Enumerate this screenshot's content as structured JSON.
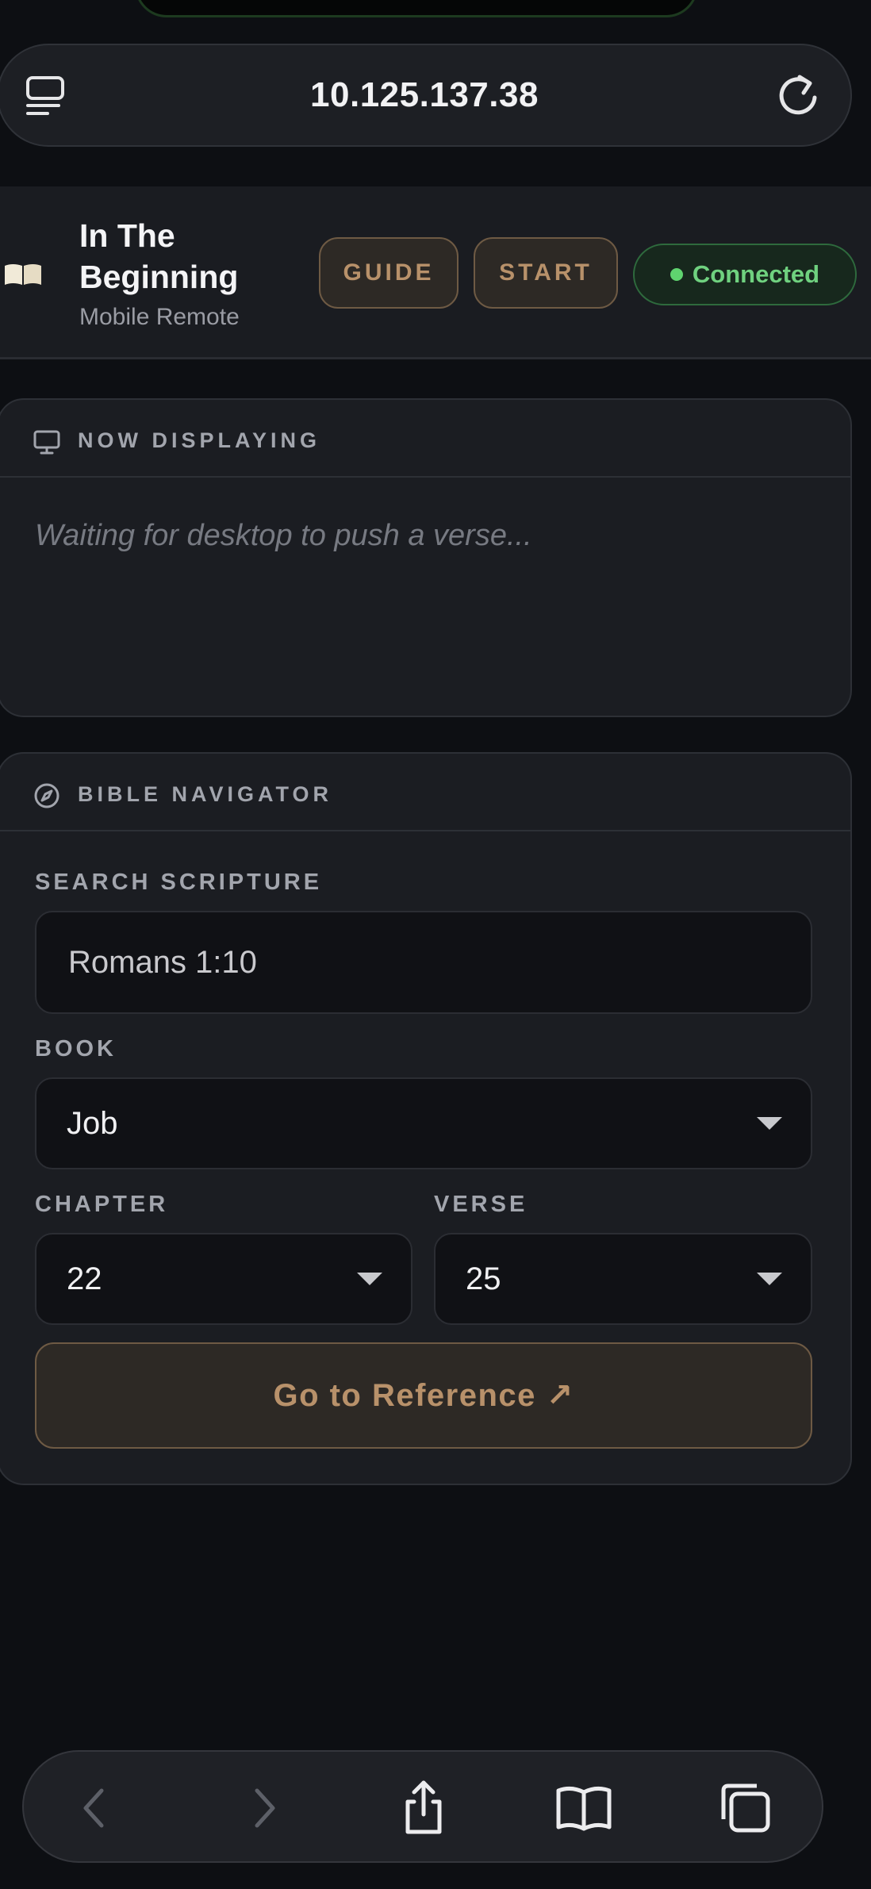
{
  "browser": {
    "address": "10.125.137.38"
  },
  "app": {
    "title": "In The Beginning",
    "subtitle": "Mobile Remote",
    "guide_label": "GUIDE",
    "start_label": "START",
    "status_label": "Connected"
  },
  "display_card": {
    "title": "NOW DISPLAYING",
    "placeholder": "Waiting for desktop to push a verse..."
  },
  "navigator": {
    "title": "BIBLE NAVIGATOR",
    "search_label": "SEARCH SCRIPTURE",
    "search_value": "Romans 1:10",
    "book_label": "BOOK",
    "book_value": "Job",
    "chapter_label": "CHAPTER",
    "chapter_value": "22",
    "verse_label": "VERSE",
    "verse_value": "25",
    "go_label": "Go to Reference ↗"
  },
  "colors": {
    "accent": "#b8916a",
    "status_green": "#6fd17f",
    "background": "#0d0f13"
  },
  "icons": {
    "toolbar": [
      "back-icon",
      "forward-icon",
      "share-icon",
      "bookmarks-icon",
      "tabs-icon"
    ]
  }
}
